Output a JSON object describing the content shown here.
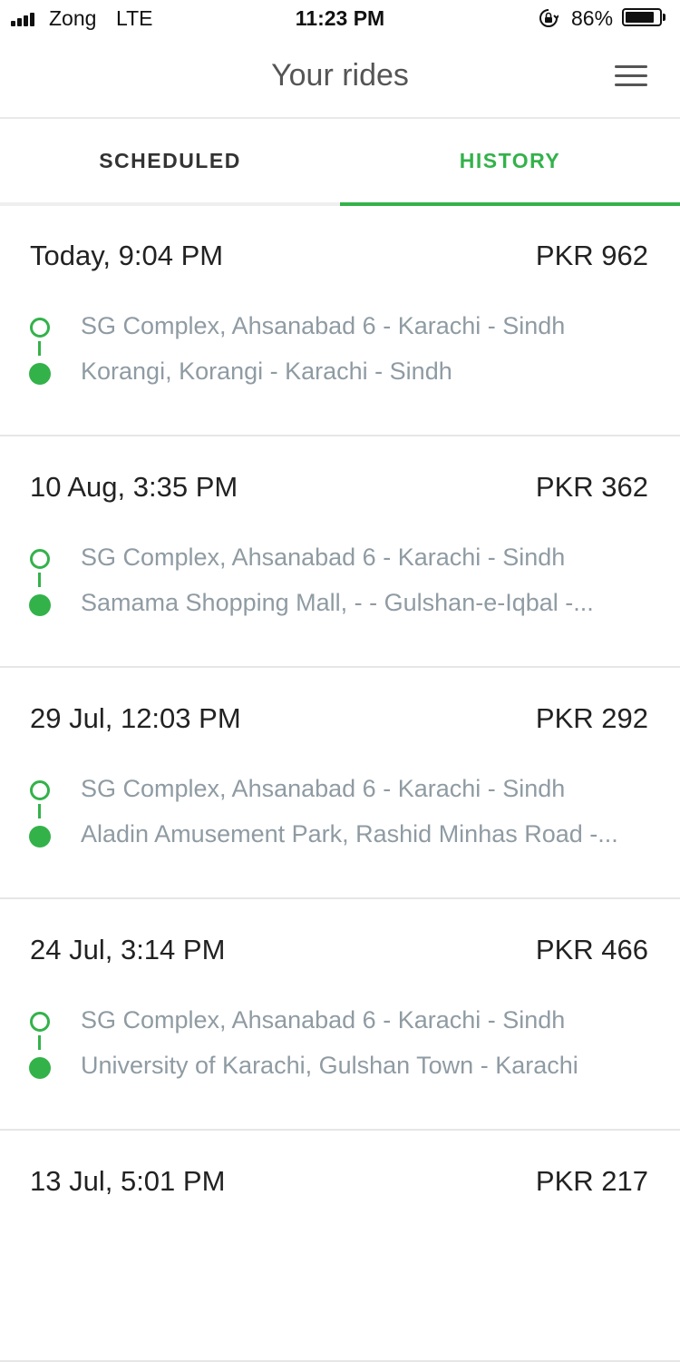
{
  "status_bar": {
    "carrier": "Zong",
    "network": "LTE",
    "time": "11:23 PM",
    "battery_percent": "86%",
    "battery_level": 0.86,
    "icons": [
      "signal-bars-icon",
      "rotation-lock-icon",
      "battery-icon"
    ]
  },
  "header": {
    "title": "Your rides",
    "menu_icon": "hamburger-menu-icon"
  },
  "tabs": [
    {
      "label": "SCHEDULED",
      "active": false
    },
    {
      "label": "HISTORY",
      "active": true
    }
  ],
  "colors": {
    "accent": "#33b24a",
    "address_text": "#8f9ba3",
    "primary_text": "#222222"
  },
  "rides": [
    {
      "date": "Today, 9:04 PM",
      "fare": "PKR 962",
      "pickup": "SG Complex, Ahsanabad 6 - Karachi - Sindh",
      "dropoff": "Korangi, Korangi - Karachi - Sindh"
    },
    {
      "date": "10 Aug, 3:35 PM",
      "fare": "PKR 362",
      "pickup": "SG Complex, Ahsanabad 6 - Karachi - Sindh",
      "dropoff": "Samama Shopping Mall, - - Gulshan-e-Iqbal -..."
    },
    {
      "date": "29 Jul, 12:03 PM",
      "fare": "PKR 292",
      "pickup": "SG Complex, Ahsanabad 6 - Karachi - Sindh",
      "dropoff": "Aladin Amusement Park, Rashid Minhas Road -..."
    },
    {
      "date": "24 Jul, 3:14 PM",
      "fare": "PKR 466",
      "pickup": "SG Complex, Ahsanabad 6 - Karachi - Sindh",
      "dropoff": "University of Karachi, Gulshan Town - Karachi"
    },
    {
      "date": "13 Jul, 5:01 PM",
      "fare": "PKR 217",
      "pickup": "",
      "dropoff": ""
    }
  ]
}
